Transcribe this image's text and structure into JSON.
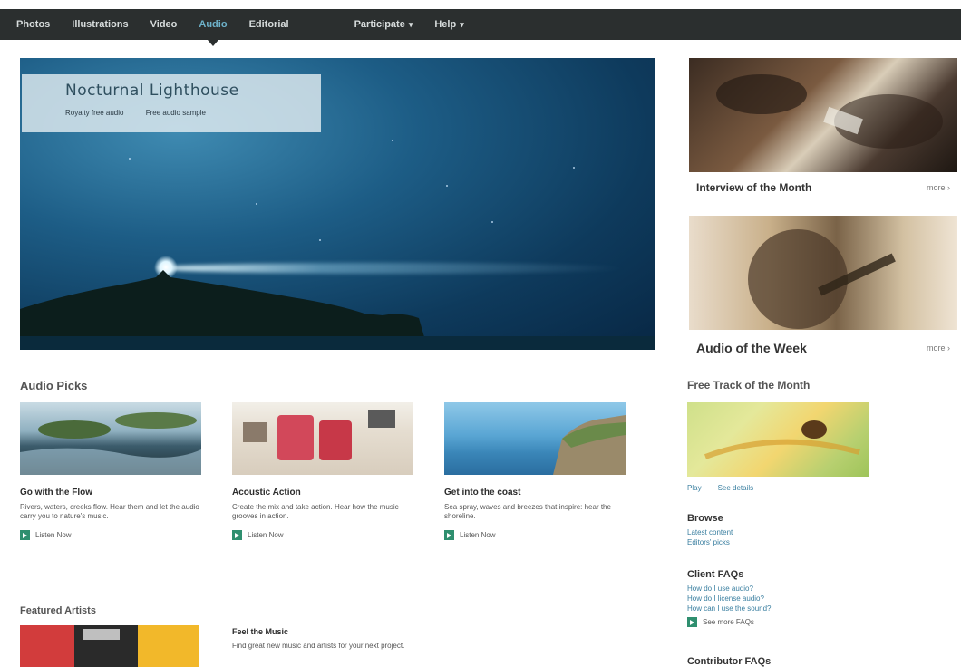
{
  "nav": {
    "items": [
      {
        "label": "Photos",
        "active": false
      },
      {
        "label": "Illustrations",
        "active": false
      },
      {
        "label": "Video",
        "active": false
      },
      {
        "label": "Audio",
        "active": true
      },
      {
        "label": "Editorial",
        "active": false
      },
      {
        "label": "Participate",
        "active": false,
        "dropdown": true
      },
      {
        "label": "Help",
        "active": false,
        "dropdown": true
      }
    ]
  },
  "hero": {
    "title": "Nocturnal Lighthouse",
    "links": [
      "Royalty free audio",
      "Free audio sample"
    ]
  },
  "sidebar": {
    "card1": {
      "title": "Interview of the Month",
      "more": "more"
    },
    "card2": {
      "title": "Audio of the Week",
      "more": "more"
    },
    "free_track": {
      "title": "Free Track of the Month",
      "links": [
        "Play",
        "See details"
      ]
    },
    "browse": {
      "title": "Browse",
      "links": [
        "Latest content",
        "Editors' picks"
      ]
    },
    "client_faqs": {
      "title": "Client FAQs",
      "links": [
        "How do I use audio?",
        "How do I license audio?",
        "How can I use the sound?"
      ],
      "more": "See more FAQs"
    },
    "contributor_faqs": {
      "title": "Contributor FAQs"
    }
  },
  "audio_picks": {
    "title": "Audio Picks",
    "items": [
      {
        "title": "Go with the Flow",
        "desc": "Rivers, waters, creeks flow. Hear them and let the audio carry you to nature's music.",
        "listen": "Listen Now"
      },
      {
        "title": "Acoustic Action",
        "desc": "Create the mix and take action. Hear how the music grooves in action.",
        "listen": "Listen Now"
      },
      {
        "title": "Get into the coast",
        "desc": "Sea spray, waves and breezes that inspire: hear the shoreline.",
        "listen": "Listen Now"
      }
    ]
  },
  "featured": {
    "title": "Featured Artists",
    "item_title": "Feel the Music",
    "item_desc": "Find great new music and artists for your next project."
  },
  "colors": {
    "nav_bg": "#2b2f2f",
    "accent": "#6db1c9",
    "link": "#3a7fa0",
    "play": "#2f8f6f"
  }
}
